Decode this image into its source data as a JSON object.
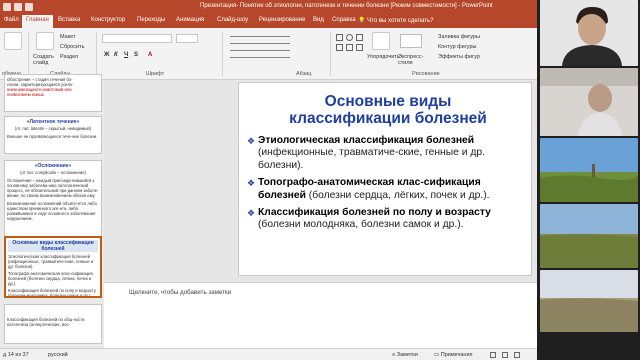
{
  "window": {
    "title": "Презентация- Понятие об этиологии, патогенезе и течении болезни [Режим совместимости] - PowerPoint"
  },
  "ribbon_tabs": [
    {
      "label": "Файл",
      "active": false
    },
    {
      "label": "Главная",
      "active": true
    },
    {
      "label": "Вставка",
      "active": false
    },
    {
      "label": "Конструктор",
      "active": false
    },
    {
      "label": "Переходы",
      "active": false
    },
    {
      "label": "Анимация",
      "active": false
    },
    {
      "label": "Слайд-шоу",
      "active": false
    },
    {
      "label": "Рецензирование",
      "active": false
    },
    {
      "label": "Вид",
      "active": false
    },
    {
      "label": "Справка",
      "active": false
    }
  ],
  "help_search": "Что вы хотите сделать?",
  "ribbon": {
    "clipboard_label": "обмена",
    "slides_label": "Слайды",
    "create_slide": "Создать слайд",
    "layout": "Макет",
    "reset": "Сбросить",
    "section": "Раздел",
    "font_label": "Шрифт",
    "paragraph_label": "Абзац",
    "drawing_label": "Рисование",
    "arrange": "Упорядочить",
    "express_styles": "Экспресс-стили",
    "shape_fill": "Заливка фигуры",
    "shape_outline": "Контур фигуры",
    "shape_effects": "Эффекты фигур"
  },
  "thumbnails": {
    "t1_lines": [
      "Обострение – стадия течения бо-",
      "лезни, характеризующаяся усиле-",
      "нием имеющихся симптомов или",
      "появлением новых."
    ],
    "t2_title": "«Латентное течение»",
    "t2_sub": "(от. лат. latentis – скрытый, невидимый)",
    "t2_body": "Внешне не проявляющееся тече-ние болезни.",
    "t3_title": "«Осложнение»",
    "t3_sub": "(от лат. complicatio – осложнение)",
    "t3_body": "Осложнение – каждый присоеди-нившийся к основному заболева-нию патологический процесс, не обязательный при данном заболе-вании, но своим возникновением обязан ему.",
    "t3_body2": "Возникновение осложнений объясн-ется либо единством причинного аге-нта, либо развившимся в ходе основно-го заболевания нарушением.",
    "t4_title": "Основные виды классификации болезней",
    "t4_i1": "Этиологическая классификация болезней (инфекционные, травматиче-ские, генные и др. болезни).",
    "t4_i2": "Топографо-анатомическая клас-сификация болезней (болезни сердца, лёгких, почек и др.).",
    "t4_i3": "Классификация болезней по полу и возрасту (болезни молодняка, болезни самок и др.).",
    "t5_body": "Классификация болезней по общ-ности патогенеза (аллергические, вос-"
  },
  "slide": {
    "title_line1": "Основные виды",
    "title_line2": "классификации болезней",
    "bullets": [
      {
        "bold": "Этиологическая классификация болезней",
        "rest": " (инфекционные, травматиче-ские, генные и др. болезни)."
      },
      {
        "bold": "Топографо-анатомическая клас-сификация болезней",
        "rest": " (болезни сердца, лёгких, почек и др.)."
      },
      {
        "bold": "Классификация болезней по полу и возрасту",
        "rest": " (болезни молодняка, болезни самок и др.)."
      }
    ],
    "bullet_glyph": "❖"
  },
  "notes_placeholder": "Щелкните, чтобы добавить заметки",
  "status": {
    "slide_counter": "д 14 из 37",
    "language": "русский",
    "notes": "Заметки",
    "comments": "Примечания"
  },
  "colors": {
    "accent": "#b7472a",
    "slide_title": "#1f3f9f",
    "selected_thumb": "#c55a11"
  }
}
